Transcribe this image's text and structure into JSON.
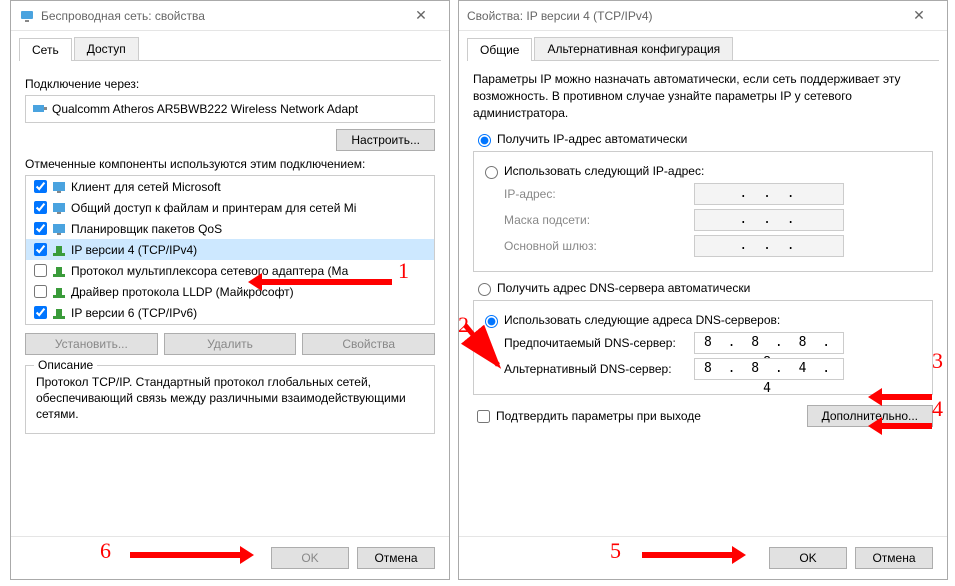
{
  "left_window": {
    "title": "Беспроводная сеть: свойства",
    "tabs": {
      "network": "Сеть",
      "access": "Доступ"
    },
    "connect_via_label": "Подключение через:",
    "adapter_name": "Qualcomm Atheros AR5BWB222 Wireless Network Adapt",
    "configure_btn": "Настроить...",
    "components_label": "Отмеченные компоненты используются этим подключением:",
    "components": [
      {
        "checked": true,
        "label": "Клиент для сетей Microsoft",
        "icon": "client"
      },
      {
        "checked": true,
        "label": "Общий доступ к файлам и принтерам для сетей Mi",
        "icon": "share"
      },
      {
        "checked": true,
        "label": "Планировщик пакетов QoS",
        "icon": "qos"
      },
      {
        "checked": true,
        "label": "IP версии 4 (TCP/IPv4)",
        "icon": "proto",
        "selected": true
      },
      {
        "checked": false,
        "label": "Протокол мультиплексора сетевого адаптера (Ма",
        "icon": "proto"
      },
      {
        "checked": false,
        "label": "Драйвер протокола LLDP (Майкрософт)",
        "icon": "proto"
      },
      {
        "checked": true,
        "label": "IP версии 6 (TCP/IPv6)",
        "icon": "proto"
      }
    ],
    "install_btn": "Установить...",
    "remove_btn": "Удалить",
    "properties_btn": "Свойства",
    "desc_title": "Описание",
    "desc_text": "Протокол TCP/IP. Стандартный протокол глобальных сетей, обеспечивающий связь между различными взаимодействующими сетями.",
    "ok_btn": "OK",
    "cancel_btn": "Отмена"
  },
  "right_window": {
    "title": "Свойства: IP версии 4 (TCP/IPv4)",
    "tabs": {
      "general": "Общие",
      "alt": "Альтернативная конфигурация"
    },
    "info_text": "Параметры IP можно назначать автоматически, если сеть поддерживает эту возможность. В противном случае узнайте параметры IP у сетевого администратора.",
    "ip_auto": "Получить IP-адрес автоматически",
    "ip_manual": "Использовать следующий IP-адрес:",
    "ip_addr_label": "IP-адрес:",
    "mask_label": "Маска подсети:",
    "gateway_label": "Основной шлюз:",
    "ip_placeholder": ".   .   .",
    "dns_auto": "Получить адрес DNS-сервера автоматически",
    "dns_manual": "Использовать следующие адреса DNS-серверов:",
    "pref_dns_label": "Предпочитаемый DNS-сервер:",
    "alt_dns_label": "Альтернативный DNS-сервер:",
    "pref_dns_value": "8 . 8 . 8 . 8",
    "alt_dns_value": "8 . 8 . 4 . 4",
    "validate_label": "Подтвердить параметры при выходе",
    "advanced_btn": "Дополнительно...",
    "ok_btn": "OK",
    "cancel_btn": "Отмена"
  },
  "annotations": {
    "n1": "1",
    "n2": "2",
    "n3": "3",
    "n4": "4",
    "n5": "5",
    "n6": "6",
    "color": "#ff0000"
  }
}
